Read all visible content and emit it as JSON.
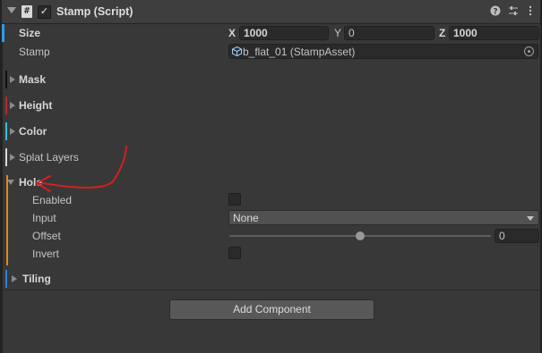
{
  "header": {
    "title": "Stamp (Script)",
    "script_glyph": "#",
    "check_glyph": "✓"
  },
  "size": {
    "label": "Size",
    "x_label": "X",
    "x": "1000",
    "y_label": "Y",
    "y": "0",
    "z_label": "Z",
    "z": "1000"
  },
  "stamp": {
    "label": "Stamp",
    "value": "b_flat_01 (StampAsset)"
  },
  "sections": {
    "mask": "Mask",
    "height": "Height",
    "color": "Color",
    "splat": "Splat Layers",
    "hole": "Hole",
    "tiling": "Tiling"
  },
  "hole": {
    "enabled_label": "Enabled",
    "input_label": "Input",
    "input_value": "None",
    "offset_label": "Offset",
    "offset_value": "0",
    "offset_fraction": 0.5,
    "invert_label": "Invert"
  },
  "add_component": "Add Component",
  "colors": {
    "mask": "#111111",
    "height": "#c0272d",
    "color": "#29c7d8",
    "splat": "#d9d9d9",
    "hole": "#e08a1d",
    "tiling": "#2f7fd6",
    "size": "#2f9be6",
    "arrow": "#d51f1f"
  }
}
